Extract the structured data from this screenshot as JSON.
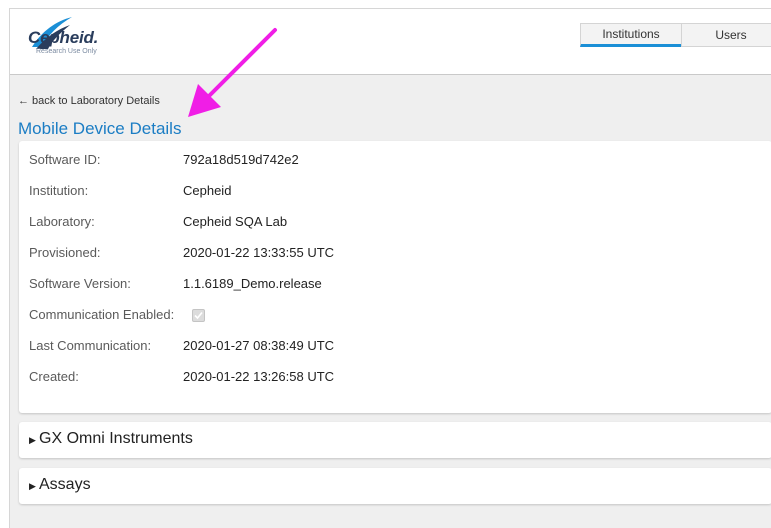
{
  "header": {
    "logo_text": "Cepheid.",
    "logo_subtext": "Research Use Only",
    "nav_tabs": [
      {
        "label": "Institutions",
        "active": true
      },
      {
        "label": "Users",
        "active": false
      }
    ]
  },
  "breadcrumb": {
    "back_label": "← back to Laboratory Details"
  },
  "page_title": "Mobile Device Details",
  "details": [
    {
      "label": "Software ID:",
      "value": "792a18d519d742e2"
    },
    {
      "label": "Institution:",
      "value": "Cepheid"
    },
    {
      "label": "Laboratory:",
      "value": "Cepheid SQA Lab"
    },
    {
      "label": "Provisioned:",
      "value": "2020-01-22 13:33:55 UTC"
    },
    {
      "label": "Software Version:",
      "value": "1.1.6189_Demo.release"
    },
    {
      "label": "Communication Enabled:",
      "checked": true
    },
    {
      "label": "Last Communication:",
      "value": "2020-01-27 08:38:49 UTC"
    },
    {
      "label": "Created:",
      "value": "2020-01-22 13:26:58 UTC"
    }
  ],
  "sections": [
    {
      "label": "GX Omni Instruments",
      "icon": "caret-right-icon"
    },
    {
      "label": "Assays",
      "icon": "caret-right-icon"
    }
  ],
  "colors": {
    "accent": "#1b8fd6",
    "title": "#1b7dc4",
    "annotation_arrow": "#f01ee6",
    "background": "#efefef"
  }
}
